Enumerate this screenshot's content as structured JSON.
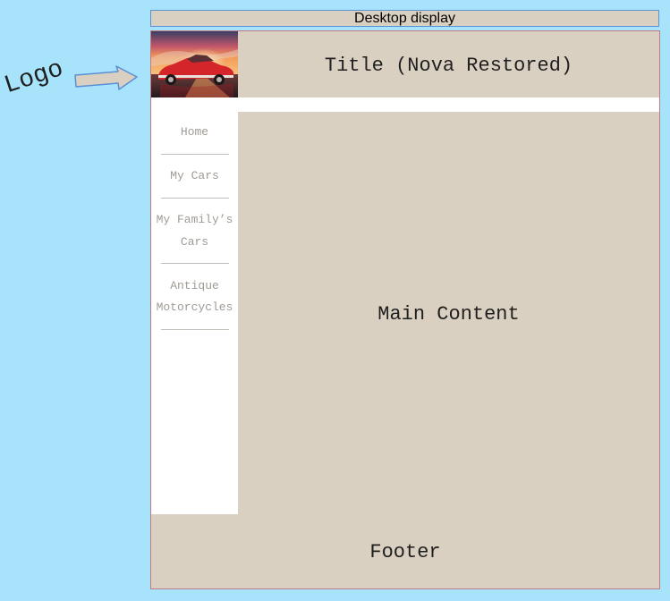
{
  "mock_label": "Desktop display",
  "annotation": {
    "logo_label": "Logo"
  },
  "header": {
    "title": "Title (Nova Restored)"
  },
  "nav": {
    "items": [
      {
        "label": "Home"
      },
      {
        "label": "My Cars"
      },
      {
        "label": "My Family’s Cars"
      },
      {
        "label": "Antique Motorcycles"
      }
    ],
    "separator": "———————————"
  },
  "main": {
    "label": "Main Content"
  },
  "footer": {
    "label": "Footer"
  },
  "colors": {
    "page_background": "#a7e3fb",
    "panel": "#dad0c2",
    "nav_background": "#ffffff",
    "nav_text": "#a09b95",
    "frame_border": "#c07a86",
    "label_border": "#5b8fd6"
  },
  "icons": {
    "logo_image": "red-classic-car-sunset-image",
    "annotation_arrow": "right-arrow-icon"
  }
}
